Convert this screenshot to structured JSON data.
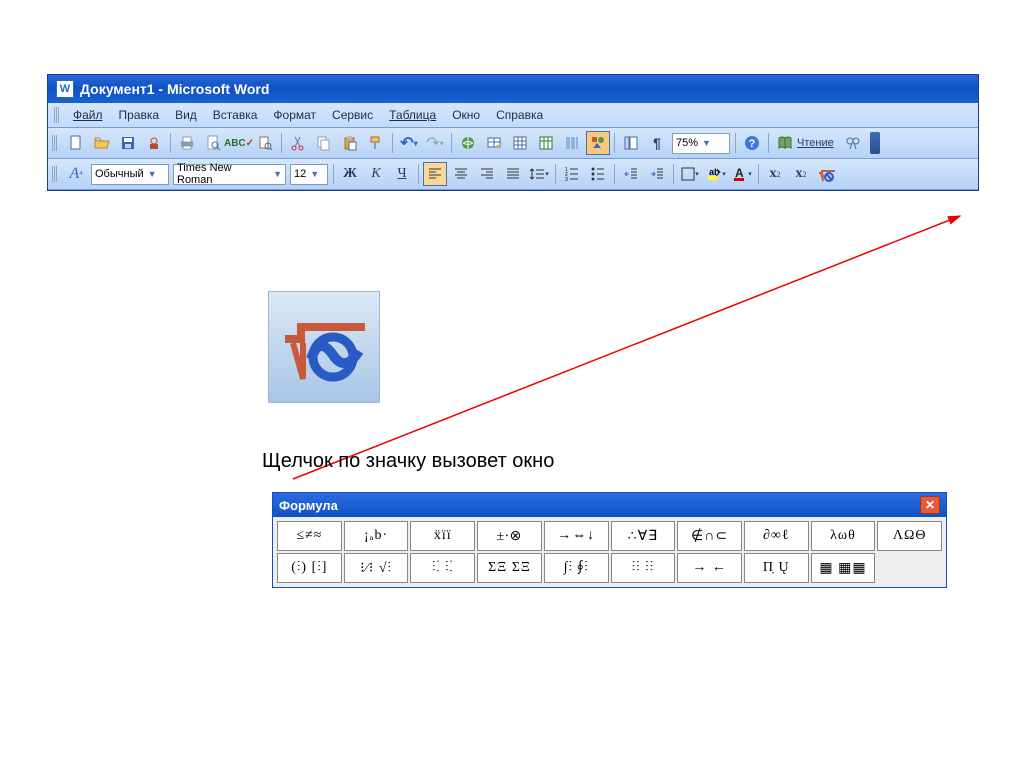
{
  "word": {
    "title": "Документ1 - Microsoft Word",
    "menu": [
      "Файл",
      "Правка",
      "Вид",
      "Вставка",
      "Формат",
      "Сервис",
      "Таблица",
      "Окно",
      "Справка"
    ],
    "zoom": "75%",
    "read": "Чтение",
    "style": "Обычный",
    "font": "Times New Roman",
    "size": "12"
  },
  "caption": "Щелчок по значку вызовет окно",
  "formula": {
    "title": "Формула",
    "row1": [
      "≤≠≈",
      "¡ₐb·",
      "ẍïï",
      "±∙⊗",
      "→⇔↓",
      "∴∀∃",
      "∉∩⊂",
      "∂∞ℓ",
      "λωθ",
      "ΛΩΘ"
    ],
    "row2": [
      "(⫶) [⫶]",
      "⁝⁄⁝ √⫶",
      "⫶⁚ ⫶⁚",
      "ΣΞ ΣΞ",
      "∫⫶ ∮⫶",
      "⫶⫶ ⫶⫶",
      "→ ←",
      "Π̣ Ų",
      "▦ ▦▦",
      ""
    ]
  }
}
